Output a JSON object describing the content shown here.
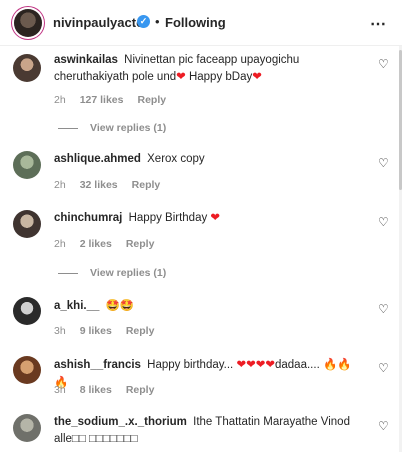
{
  "header": {
    "username": "nivinpaulyactor",
    "verified_icon": "verified-check-icon",
    "dot": "•",
    "follow_status": "Following",
    "more_icon": "⋯"
  },
  "comments": [
    {
      "user": "aswinkailas",
      "text": "Nivinettan pic faceapp upayogichu cheruthakiyath pole und",
      "text2": " Happy bDay",
      "time": "2h",
      "likes": "127 likes",
      "reply": "Reply",
      "view_replies": "View replies (1)"
    },
    {
      "user": "ashlique.ahmed",
      "text": "Xerox copy",
      "time": "2h",
      "likes": "32 likes",
      "reply": "Reply"
    },
    {
      "user": "chinchumraj",
      "text": "Happy Birthday",
      "time": "2h",
      "likes": "2 likes",
      "reply": "Reply",
      "view_replies": "View replies (1)"
    },
    {
      "user": "a_khi.__",
      "text": "🤩🤩",
      "time": "3h",
      "likes": "9 likes",
      "reply": "Reply"
    },
    {
      "user": "ashish__francis",
      "text": "Happy birthday...",
      "text2": "dadaa....",
      "time": "3h",
      "likes": "8 likes",
      "reply": "Reply"
    },
    {
      "user": "the_sodium_.x._thorium",
      "text": "Ithe Thattatin Marayathe Vinod alle□□ □□□□□□□"
    }
  ],
  "heart_emoji": "❤",
  "fire_emoji": "🔥🔥🔥",
  "like_icon": "♡"
}
